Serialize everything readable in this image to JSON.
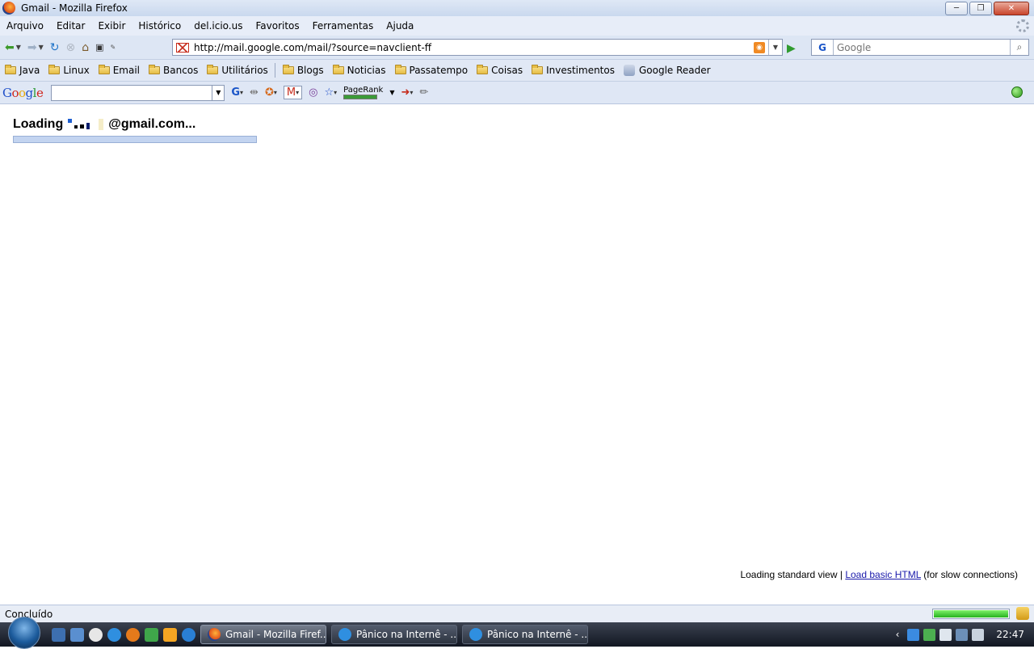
{
  "window": {
    "title": "Gmail - Mozilla Firefox",
    "buttons": {
      "minimize": "─",
      "maximize": "❐",
      "close": "✕"
    }
  },
  "menu": [
    "Arquivo",
    "Editar",
    "Exibir",
    "Histórico",
    "del.icio.us",
    "Favoritos",
    "Ferramentas",
    "Ajuda"
  ],
  "nav": {
    "url": "http://mail.google.com/mail/?source=navclient-ff",
    "search_placeholder": "Google"
  },
  "bookmarks": [
    {
      "label": "Java"
    },
    {
      "label": "Linux"
    },
    {
      "label": "Email"
    },
    {
      "label": "Bancos"
    },
    {
      "label": "Utilitários"
    },
    {
      "label": "Blogs"
    },
    {
      "label": "Noticias"
    },
    {
      "label": "Passatempo"
    },
    {
      "label": "Coisas"
    },
    {
      "label": "Investimentos"
    },
    {
      "label": "Google Reader"
    }
  ],
  "googlebar": {
    "logo": "Google",
    "pagerank_label": "PageRank"
  },
  "page": {
    "loading_prefix": "Loading",
    "loading_suffix": "@gmail.com...",
    "progress_fraction": 1.0,
    "footer_prefix": "Loading standard view |",
    "footer_link": "Load basic HTML",
    "footer_suffix": "(for slow connections)"
  },
  "status": {
    "text": "Concluído",
    "meter_fraction": 1.0
  },
  "taskbar": {
    "tasks": [
      {
        "label": "Gmail - Mozilla Firef...",
        "active": true
      },
      {
        "label": "Pânico na Internê - ...",
        "active": false
      },
      {
        "label": "Pânico na Internê - ...",
        "active": false
      }
    ],
    "clock": "22:47"
  },
  "colors": {
    "link": "#1a1aab",
    "progress_fill": "#c3d4f0",
    "meter_fill": "#26b21f"
  }
}
